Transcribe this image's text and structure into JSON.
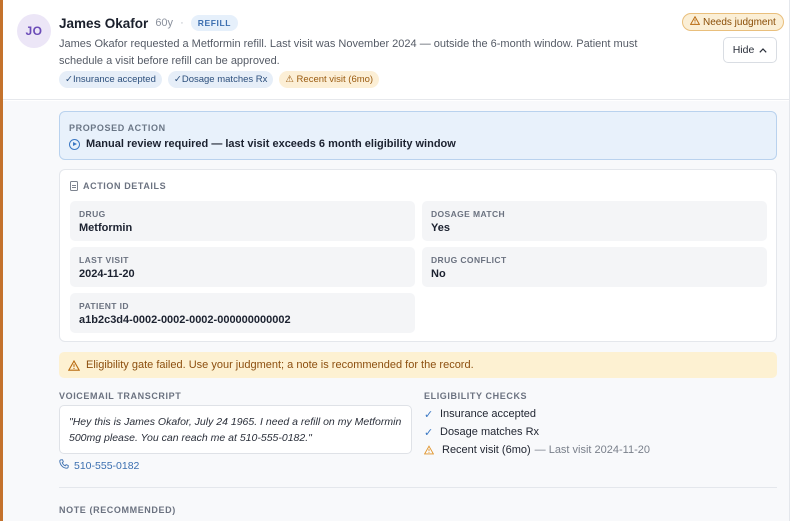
{
  "patient": {
    "initials": "JO",
    "name": "James Okafor",
    "age": "60y",
    "separator": "·",
    "request_type": "REFILL",
    "summary": "James Okafor requested a Metformin refill. Last visit was November 2024 — outside the 6-month window. Patient must schedule a visit before refill can be approved."
  },
  "status_badge": {
    "icon": "warning-triangle-icon",
    "label": "Needs judgment"
  },
  "hide_button": {
    "label": "Hide",
    "icon": "chevron-up-icon"
  },
  "chips": [
    {
      "label": "✓Insurance accepted",
      "status": "ok"
    },
    {
      "label": "✓Dosage matches Rx",
      "status": "ok"
    },
    {
      "label": "⚠ Recent visit (6mo)",
      "status": "warn"
    }
  ],
  "proposed_action": {
    "label": "PROPOSED ACTION",
    "text": "Manual review required — last visit exceeds 6 month eligibility window"
  },
  "action_details": {
    "label": "ACTION DETAILS",
    "fields": {
      "drug": {
        "label": "DRUG",
        "value": "Metformin"
      },
      "dosage_match": {
        "label": "DOSAGE MATCH",
        "value": "Yes"
      },
      "last_visit": {
        "label": "LAST VISIT",
        "value": "2024-11-20"
      },
      "drug_conflict": {
        "label": "DRUG CONFLICT",
        "value": "No"
      },
      "patient_id": {
        "label": "PATIENT ID",
        "value": "a1b2c3d4-0002-0002-0002-000000000002"
      }
    }
  },
  "eligibility_banner": "Eligibility gate failed. Use your judgment; a note is recommended for the record.",
  "voicemail": {
    "label": "VOICEMAIL TRANSCRIPT",
    "transcript": "\"Hey this is James Okafor, July 24 1965. I need a refill on my Metformin 500mg please. You can reach me at 510-555-0182.\"",
    "phone": "510-555-0182"
  },
  "eligibility_checks": {
    "label": "ELIGIBILITY CHECKS",
    "items": [
      {
        "mark": "✓",
        "label": "Insurance accepted",
        "detail": ""
      },
      {
        "mark": "✓",
        "label": "Dosage matches Rx",
        "detail": ""
      },
      {
        "mark": "⚠",
        "label": "Recent visit (6mo)",
        "detail": "— Last visit 2024-11-20"
      }
    ]
  },
  "note": {
    "label": "NOTE (RECOMMENDED)"
  },
  "colors": {
    "accent_bar": "#c4722c",
    "warning": "#e0942a",
    "info_blue": "#3b78c4"
  }
}
